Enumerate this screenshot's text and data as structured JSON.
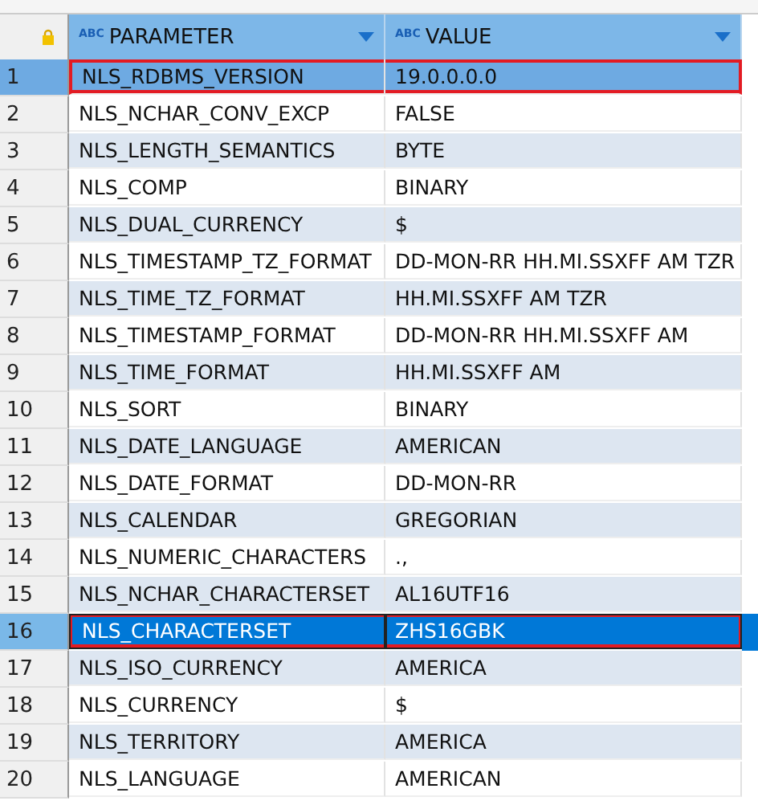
{
  "table": {
    "columns": [
      {
        "label": "PARAMETER",
        "type_badge": "ABC"
      },
      {
        "label": "VALUE",
        "type_badge": "ABC"
      }
    ],
    "rows": [
      {
        "number": "1",
        "parameter": "NLS_RDBMS_VERSION",
        "value": "19.0.0.0.0",
        "selected": false,
        "hovered": true,
        "outlined": true
      },
      {
        "number": "2",
        "parameter": "NLS_NCHAR_CONV_EXCP",
        "value": "FALSE",
        "selected": false,
        "hovered": false,
        "outlined": false
      },
      {
        "number": "3",
        "parameter": "NLS_LENGTH_SEMANTICS",
        "value": "BYTE",
        "selected": false,
        "hovered": false,
        "outlined": false
      },
      {
        "number": "4",
        "parameter": "NLS_COMP",
        "value": "BINARY",
        "selected": false,
        "hovered": false,
        "outlined": false
      },
      {
        "number": "5",
        "parameter": "NLS_DUAL_CURRENCY",
        "value": "$",
        "selected": false,
        "hovered": false,
        "outlined": false
      },
      {
        "number": "6",
        "parameter": "NLS_TIMESTAMP_TZ_FORMAT",
        "value": "DD-MON-RR HH.MI.SSXFF AM TZR",
        "selected": false,
        "hovered": false,
        "outlined": false
      },
      {
        "number": "7",
        "parameter": "NLS_TIME_TZ_FORMAT",
        "value": "HH.MI.SSXFF AM TZR",
        "selected": false,
        "hovered": false,
        "outlined": false
      },
      {
        "number": "8",
        "parameter": "NLS_TIMESTAMP_FORMAT",
        "value": "DD-MON-RR HH.MI.SSXFF AM",
        "selected": false,
        "hovered": false,
        "outlined": false
      },
      {
        "number": "9",
        "parameter": "NLS_TIME_FORMAT",
        "value": "HH.MI.SSXFF AM",
        "selected": false,
        "hovered": false,
        "outlined": false
      },
      {
        "number": "10",
        "parameter": "NLS_SORT",
        "value": "BINARY",
        "selected": false,
        "hovered": false,
        "outlined": false
      },
      {
        "number": "11",
        "parameter": "NLS_DATE_LANGUAGE",
        "value": "AMERICAN",
        "selected": false,
        "hovered": false,
        "outlined": false
      },
      {
        "number": "12",
        "parameter": "NLS_DATE_FORMAT",
        "value": "DD-MON-RR",
        "selected": false,
        "hovered": false,
        "outlined": false
      },
      {
        "number": "13",
        "parameter": "NLS_CALENDAR",
        "value": "GREGORIAN",
        "selected": false,
        "hovered": false,
        "outlined": false
      },
      {
        "number": "14",
        "parameter": "NLS_NUMERIC_CHARACTERS",
        "value": ".,",
        "selected": false,
        "hovered": false,
        "outlined": false
      },
      {
        "number": "15",
        "parameter": "NLS_NCHAR_CHARACTERSET",
        "value": "AL16UTF16",
        "selected": false,
        "hovered": false,
        "outlined": false
      },
      {
        "number": "16",
        "parameter": "NLS_CHARACTERSET",
        "value": "ZHS16GBK",
        "selected": true,
        "hovered": false,
        "outlined": true
      },
      {
        "number": "17",
        "parameter": "NLS_ISO_CURRENCY",
        "value": "AMERICA",
        "selected": false,
        "hovered": false,
        "outlined": false
      },
      {
        "number": "18",
        "parameter": "NLS_CURRENCY",
        "value": "$",
        "selected": false,
        "hovered": false,
        "outlined": false
      },
      {
        "number": "19",
        "parameter": "NLS_TERRITORY",
        "value": "AMERICA",
        "selected": false,
        "hovered": false,
        "outlined": false
      },
      {
        "number": "20",
        "parameter": "NLS_LANGUAGE",
        "value": "AMERICAN",
        "selected": false,
        "hovered": false,
        "outlined": false
      }
    ]
  }
}
